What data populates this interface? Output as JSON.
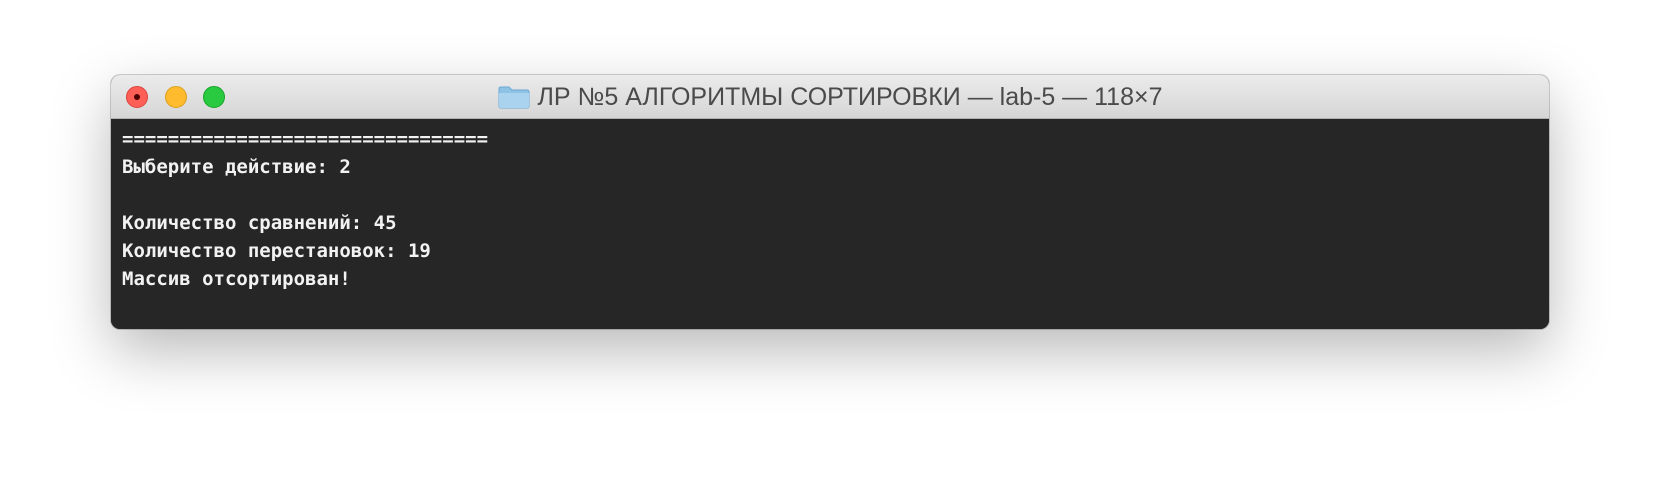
{
  "window": {
    "title": "ЛР №5 АЛГОРИТМЫ СОРТИРОВКИ — lab-5 — 118×7",
    "folder_icon": "folder-icon",
    "traffic_lights": {
      "close_color": "#fd5f57",
      "minimize_color": "#febb2d",
      "zoom_color": "#29c940"
    }
  },
  "terminal": {
    "background": "#262626",
    "foreground": "#f2f2f2",
    "lines": [
      "================================",
      "Выберите действие: 2",
      "",
      "Количество сравнений: 45",
      "Количество перестановок: 19",
      "Массив отсортирован!"
    ]
  }
}
